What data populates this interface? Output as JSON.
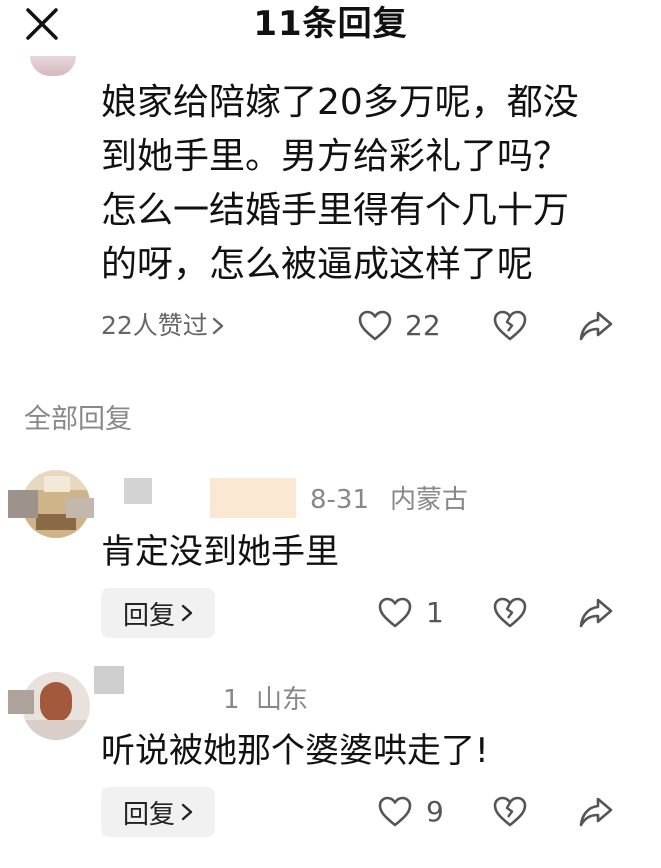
{
  "header": {
    "title": "11条回复"
  },
  "post": {
    "lines": [
      "娘家给陪嫁了20多万呢，都没",
      "到她手里。男方给彩礼了吗？",
      "怎么一结婚手里得有个几十万",
      "的呀，怎么被逼成这样了呢"
    ],
    "likes_summary": "22人赞过",
    "like_count": "22"
  },
  "section": {
    "label": "全部回复"
  },
  "comments": [
    {
      "date": "8-31",
      "location": "内蒙古",
      "text": "肯定没到她手里",
      "reply_label": "回复",
      "like_count": "1"
    },
    {
      "date": "1",
      "location": "山东",
      "text": "听说被她那个婆婆哄走了!",
      "reply_label": "回复",
      "like_count": "9"
    }
  ],
  "icons": [
    "close-icon",
    "heart-icon",
    "broken-heart-icon",
    "share-icon",
    "chevron-right-icon"
  ]
}
